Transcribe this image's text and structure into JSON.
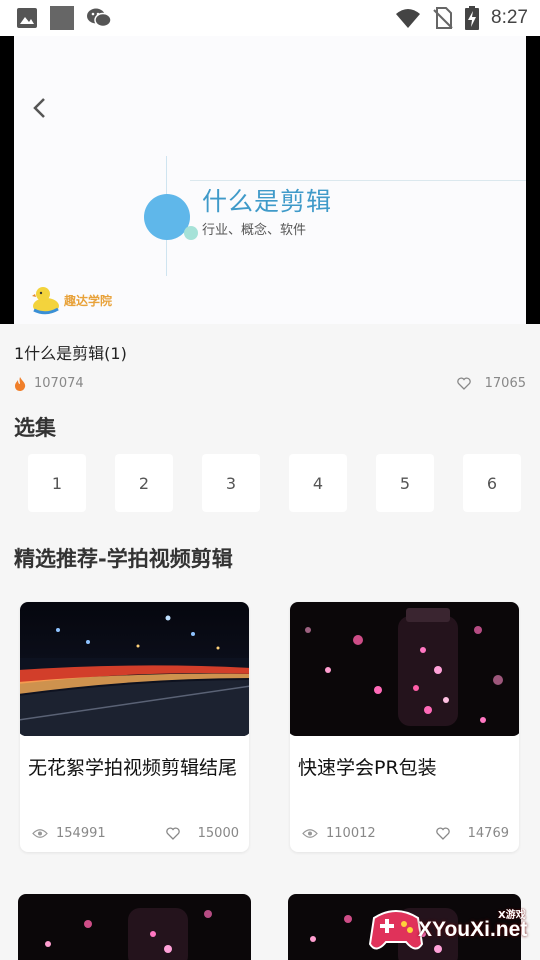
{
  "status_bar": {
    "time": "8:27"
  },
  "video": {
    "slide_title": "什么是剪辑",
    "slide_subtitle": "行业、概念、软件",
    "logo_text": "趣达学院"
  },
  "episode": {
    "title": "1什么是剪辑(1)",
    "plays": "107074",
    "likes": "17065"
  },
  "episode_section": {
    "title": "选集",
    "items": [
      "1",
      "2",
      "3",
      "4",
      "5",
      "6"
    ]
  },
  "recommend_section": {
    "title": "精选推荐-学拍视频剪辑",
    "cards": [
      {
        "title": "无花絮学拍视频剪辑结尾",
        "views": "154991",
        "likes": "15000"
      },
      {
        "title": "快速学会PR包装",
        "views": "110012",
        "likes": "14769"
      }
    ]
  },
  "watermark": {
    "text": "XYouXi.net",
    "small": "X游戏"
  }
}
